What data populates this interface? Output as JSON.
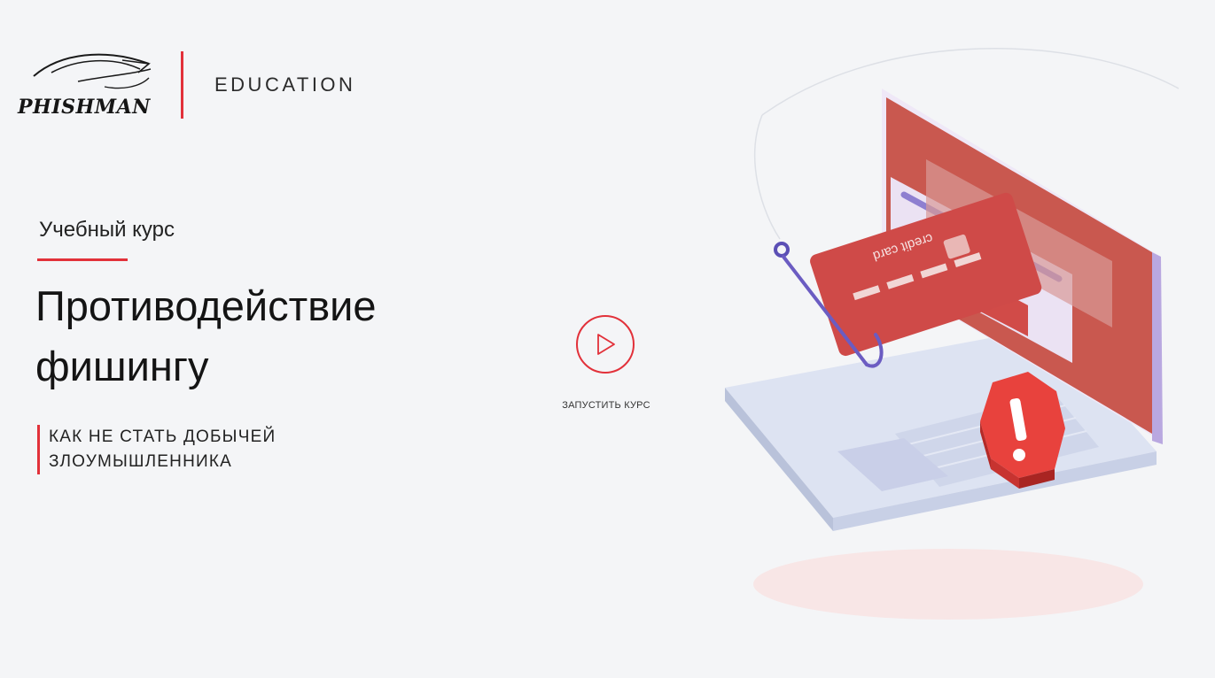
{
  "brand": {
    "logo_text": "PHISHMAN",
    "product": "EDUCATION"
  },
  "course": {
    "kicker": "Учебный курс",
    "title_line1": "Противодействие",
    "title_line2": "фишингу",
    "subtitle_line1": "КАК НЕ СТАТЬ ДОБЫЧЕЙ",
    "subtitle_line2": "ЗЛОУМЫШЛЕННИКА"
  },
  "launch": {
    "label": "ЗАПУСТИТЬ КУРС",
    "icon": "play-icon"
  },
  "illustration": {
    "card_text": "credit card",
    "warning_icon": "exclamation-icon"
  },
  "colors": {
    "accent": "#e2313a",
    "background": "#f4f5f7",
    "card": "#cf4a48",
    "laptop": "#dde3f2",
    "purple": "#8e7fd0"
  }
}
